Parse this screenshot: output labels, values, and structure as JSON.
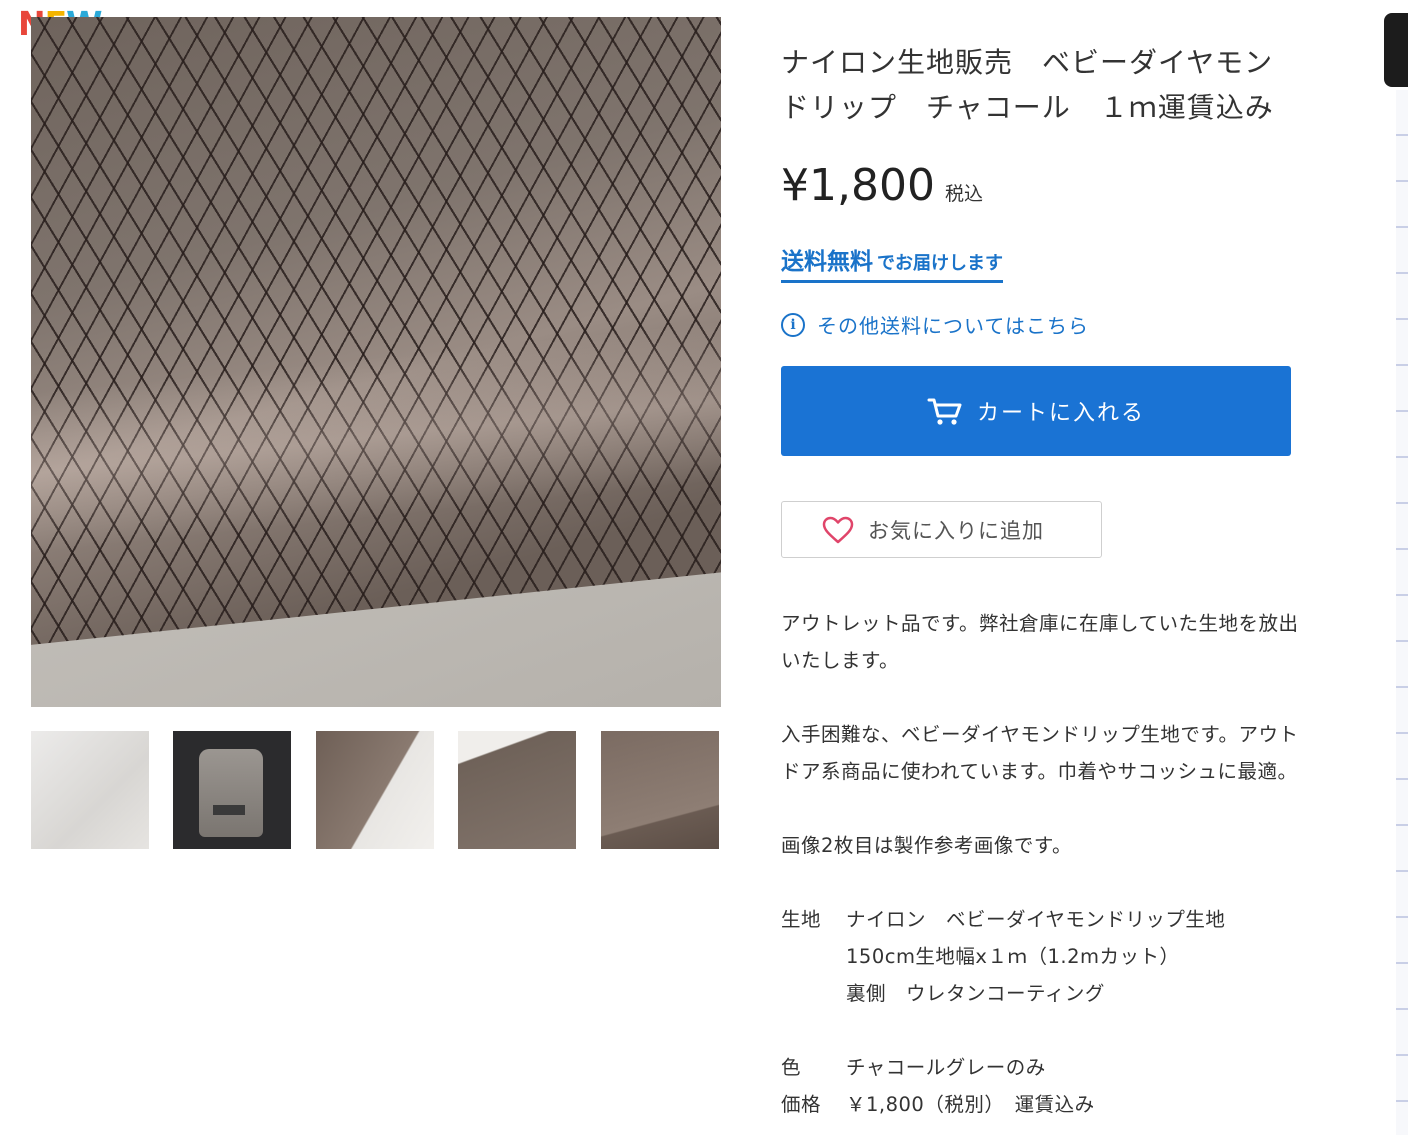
{
  "badge": {
    "letters": [
      "N",
      "E",
      "W"
    ]
  },
  "product": {
    "title_line1": "ナイロン生地販売　ベビーダイヤモン",
    "title_line2": "ドリップ　チャコール　１ｍ運賃込み",
    "price": "¥1,800",
    "tax_label": "税込",
    "shipping_strong": "送料無料",
    "shipping_rest": "でお届けします",
    "other_shipping_link": "その他送料についてはこちら",
    "cart_button": "カートに入れる",
    "favorite_button": "お気に入りに追加"
  },
  "description": {
    "p1_line1": "アウトレット品です。弊社倉庫に在庫していた生地を放出",
    "p1_line2": "いたします。",
    "p2_line1": "入手困難な、ベビーダイヤモンドリップ生地です。アウト",
    "p2_line2": "ドア系商品に使われています。巾着やサコッシュに最適。",
    "p3": "画像2枚目は製作参考画像です。",
    "specs": [
      {
        "key": "生地",
        "values": [
          "ナイロン　ベビーダイヤモンドリップ生地",
          "150cm生地幅x１ｍ（1.2mカット）",
          "裏側　ウレタンコーティング"
        ]
      },
      {
        "key": "色",
        "values": [
          "チャコールグレーのみ"
        ]
      },
      {
        "key": "価格",
        "values": [
          "￥1,800（税別）　運賃込み"
        ]
      }
    ]
  },
  "colors": {
    "accent": "#1a73d4",
    "link": "#1a73c9",
    "heart": "#e0456a"
  },
  "icons": [
    "new-badge",
    "info-icon",
    "cart-icon",
    "heart-icon"
  ]
}
